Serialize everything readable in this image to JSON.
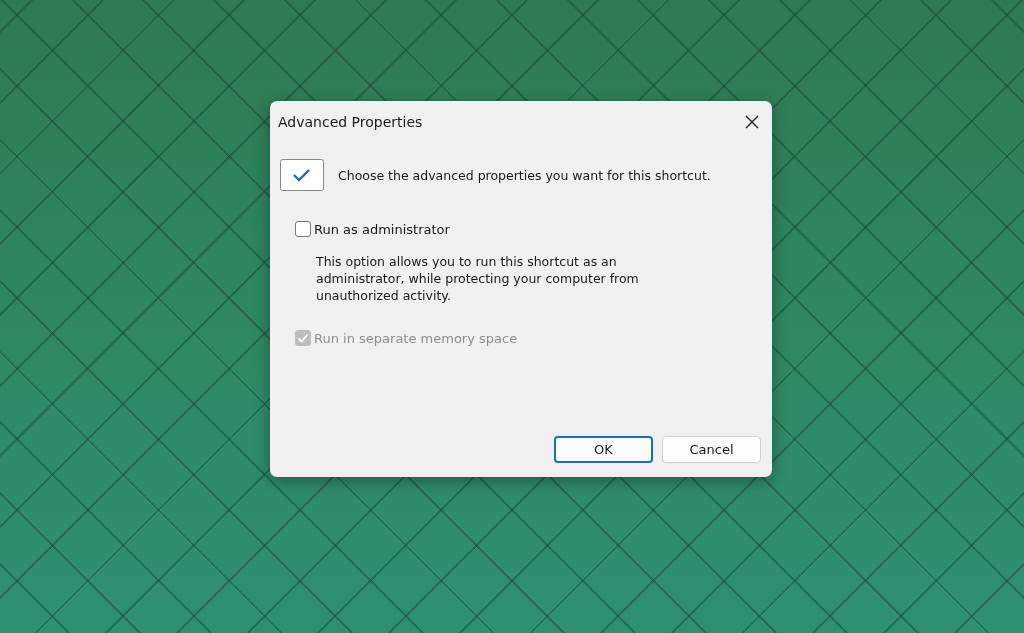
{
  "window": {
    "title": "Advanced Properties"
  },
  "header": {
    "text": "Choose the advanced properties you want for this shortcut."
  },
  "options": [
    {
      "kind": "checkbox",
      "label": "Run as administrator",
      "checked": false,
      "disabled": false,
      "description": "This option allows you to run this shortcut as an administrator, while protecting your computer from unauthorized activity."
    },
    {
      "kind": "checkbox",
      "label": "Run in separate memory space",
      "checked": true,
      "disabled": true
    }
  ],
  "buttons": [
    {
      "label": "OK",
      "default": true
    },
    {
      "label": "Cancel",
      "default": false
    }
  ]
}
